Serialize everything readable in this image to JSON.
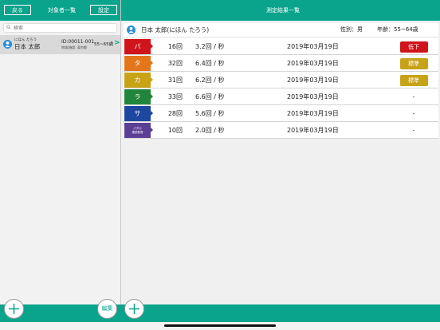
{
  "topbar": {
    "back_label": "戻る",
    "list_title": "対象者一覧",
    "settings_label": "設定",
    "results_title": "測定結果一覧"
  },
  "search": {
    "placeholder": "検索"
  },
  "person": {
    "kana": "にほん たろう",
    "name": "日本 太郎",
    "id": "ID:00011-001",
    "sub": "地域/施設: 東京都",
    "age_range": "55~65歳"
  },
  "header": {
    "name": "日本 太郎(にほん たろう)",
    "sex": "性別：男",
    "age": "年齢：55~64歳"
  },
  "results": [
    {
      "tag": "パ",
      "color": "#d0141c",
      "count": "16回",
      "rate": "3.2回 / 秒",
      "date": "2019年03月19日",
      "status": "低下",
      "status_color": "#d0141c"
    },
    {
      "tag": "タ",
      "color": "#e3761b",
      "count": "32回",
      "rate": "6.4回 / 秒",
      "date": "2019年03月19日",
      "status": "標準",
      "status_color": "#c8a217"
    },
    {
      "tag": "カ",
      "color": "#c8a217",
      "count": "31回",
      "rate": "6.2回 / 秒",
      "date": "2019年03月19日",
      "status": "標準",
      "status_color": "#c8a217"
    },
    {
      "tag": "ラ",
      "color": "#21863c",
      "count": "33回",
      "rate": "6.6回 / 秒",
      "date": "2019年03月19日",
      "status": "-",
      "status_color": ""
    },
    {
      "tag": "サ",
      "color": "#1e47a0",
      "count": "28回",
      "rate": "5.6回 / 秒",
      "date": "2019年03月19日",
      "status": "-",
      "status_color": ""
    },
    {
      "tag": "パタカ\n連続発音",
      "color": "#5b3f95",
      "count": "10回",
      "rate": "2.0回 / 秒",
      "date": "2019年03月19日",
      "status": "-",
      "status_color": ""
    }
  ],
  "bottom": {
    "edit_label": "編集"
  },
  "colors": {
    "accent": "#0aa38c"
  }
}
